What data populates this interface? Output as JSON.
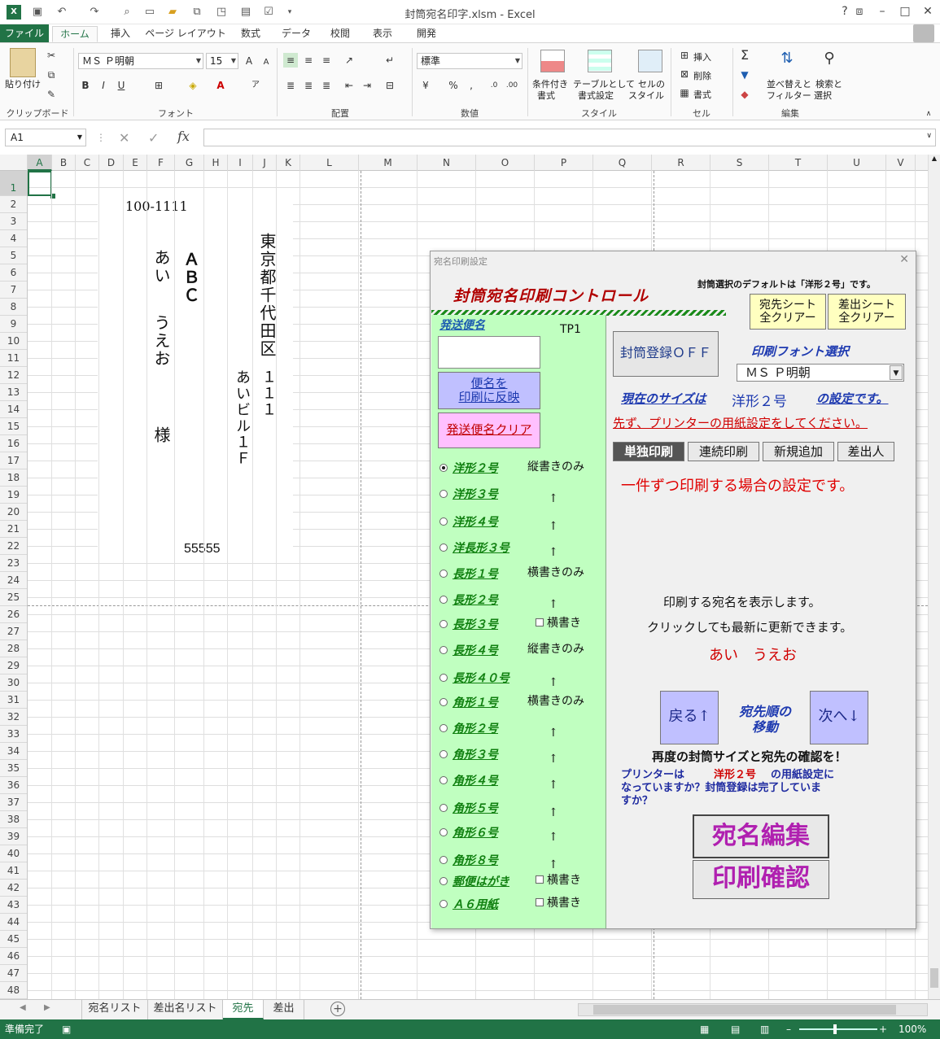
{
  "window": {
    "title": "封筒宛名印字.xlsm - Excel"
  },
  "qat": {
    "icons": [
      "excel-logo-icon",
      "save-icon",
      "undo-icon",
      "redo-icon",
      "print-preview-icon",
      "new-icon",
      "open-icon",
      "copy-format-icon",
      "camera-icon",
      "form-icon",
      "checkbox-icon",
      "more-icon"
    ]
  },
  "tabs": [
    "ファイル",
    "ホーム",
    "挿入",
    "ページ レイアウト",
    "数式",
    "データ",
    "校閲",
    "表示",
    "開発"
  ],
  "ribbon": {
    "clipboard": {
      "paste_label": "貼り付け",
      "group_label": "クリップボード"
    },
    "font": {
      "font_name": "ＭＳ Ｐ明朝",
      "font_size": "15",
      "bold": "B",
      "italic": "I",
      "underline": "U",
      "grow": "A",
      "shrink": "A",
      "group_label": "フォント"
    },
    "alignment": {
      "group_label": "配置"
    },
    "number": {
      "format": "標準",
      "percent": "%",
      "comma": ",",
      "group_label": "数値"
    },
    "styles": {
      "conditional": "条件付き\n書式",
      "conditional1": "条件付き",
      "conditional2": "書式",
      "table1": "テーブルとして",
      "table2": "書式設定",
      "cell1": "セルの",
      "cell2": "スタイル",
      "group_label": "スタイル"
    },
    "cells": {
      "insert": "挿入",
      "delete": "削除",
      "format": "書式",
      "group_label": "セル"
    },
    "editing": {
      "sort1": "並べ替えと",
      "sort2": "フィルター",
      "find1": "検索と",
      "find2": "選択",
      "group_label": "編集"
    }
  },
  "formula_bar": {
    "name_box": "A1",
    "fx": "fx",
    "value": ""
  },
  "columns": [
    "A",
    "B",
    "C",
    "D",
    "E",
    "F",
    "G",
    "H",
    "I",
    "J",
    "K",
    "L",
    "M",
    "N",
    "O",
    "P",
    "Q",
    "R",
    "S",
    "T",
    "U",
    "V"
  ],
  "rows": [
    "1",
    "2",
    "3",
    "4",
    "5",
    "6",
    "7",
    "8",
    "9",
    "10",
    "11",
    "12",
    "13",
    "14",
    "15",
    "16",
    "17",
    "18",
    "19",
    "20",
    "21",
    "22",
    "23",
    "24",
    "25",
    "26",
    "27",
    "28",
    "29",
    "30",
    "31",
    "32",
    "33",
    "34",
    "35",
    "36",
    "37",
    "38",
    "39",
    "40",
    "41",
    "42",
    "43",
    "44",
    "45",
    "46",
    "47",
    "48"
  ],
  "sheet": {
    "postal_code": "100-1111",
    "name_col1": "あい",
    "name_col1b": "うえお",
    "honorific": "様",
    "company": "ＡＢＣ",
    "address1": "東京都千代田区",
    "address_num": "１１１",
    "building": "あいビル１Ｆ",
    "footer_code": "55555"
  },
  "sheet_tabs": [
    "宛名リスト",
    "差出名リスト",
    "宛先",
    "差出"
  ],
  "status": {
    "ready": "準備完了",
    "zoom": "100%"
  },
  "dialog": {
    "title": "宛名印刷設定",
    "heading": "封筒宛名印刷コントロール",
    "default_note": "封筒選択のデフォルトは「洋形２号」です。",
    "clear_dest": "宛先シート\n全クリアー",
    "clear_dest1": "宛先シート",
    "clear_dest2": "全クリアー",
    "clear_sender1": "差出シート",
    "clear_sender2": "全クリアー",
    "mail_type_label": "発送便名",
    "tp_label": "TP1",
    "reflect_btn1": "便名を",
    "reflect_btn2": "印刷に反映",
    "clear_mail_btn": "発送便名クリア",
    "envelope_reg_btn": "封筒登録ＯＦＦ",
    "font_select_label": "印刷フォント選択",
    "font_select_value": "ＭＳ Ｐ明朝",
    "current_size_label": "現在のサイズは",
    "current_size_value": "洋形２号",
    "current_size_suffix": "の設定です。",
    "printer_warning": "先ず、プリンターの用紙設定をしてください。",
    "tabs": [
      "単独印刷",
      "連続印刷",
      "新規追加",
      "差出人"
    ],
    "single_note": "一件ずつ印刷する場合の設定です。",
    "display_note1": "印刷する宛名を表示します。",
    "display_note2": "クリックしても最新に更新できます。",
    "current_name": "あい　うえお",
    "prev_btn": "戻る↑",
    "next_btn": "次へ↓",
    "move_label1": "宛先順の",
    "move_label2": "移動",
    "confirm_note": "再度の封筒サイズと宛先の確認を！",
    "printer_q1": "プリンターは",
    "printer_q_size": "洋形２号",
    "printer_q2": "の用紙設定に",
    "printer_q3": "なっていますか？封筒登録は完了していま",
    "printer_q4": "すか？",
    "edit_btn": "宛名編集",
    "print_btn": "印刷確認",
    "envelopes": [
      {
        "label": "洋形２号",
        "note": "縦書きのみ",
        "checked": true
      },
      {
        "label": "洋形３号",
        "note": "↑"
      },
      {
        "label": "洋形４号",
        "note": "↑"
      },
      {
        "label": "洋長形３号",
        "note": "↑"
      },
      {
        "label": "長形１号",
        "note": "横書きのみ"
      },
      {
        "label": "長形２号",
        "note": "↑"
      },
      {
        "label": "長形３号",
        "note": "横書き"
      },
      {
        "label": "長形４号",
        "note": "縦書きのみ"
      },
      {
        "label": "長形４０号",
        "note": "↑"
      },
      {
        "label": "角形１号",
        "note": "横書きのみ"
      },
      {
        "label": "角形２号",
        "note": "↑"
      },
      {
        "label": "角形３号",
        "note": "↑"
      },
      {
        "label": "角形４号",
        "note": "↑"
      },
      {
        "label": "角形５号",
        "note": "↑"
      },
      {
        "label": "角形６号",
        "note": "↑"
      },
      {
        "label": "角形８号",
        "note": "↑"
      },
      {
        "label": "郵便はがき",
        "note": "横書き"
      },
      {
        "label": "Ａ６用紙",
        "note": "横書き"
      }
    ]
  }
}
